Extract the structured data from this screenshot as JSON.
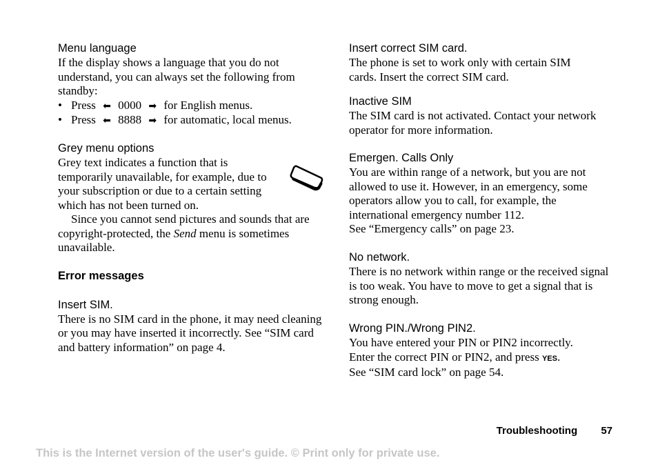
{
  "left_column": {
    "menu_language": {
      "heading": "Menu language",
      "body": "If the display shows a language that you do not understand, you can always set the following from standby:",
      "bullets": [
        {
          "press": "Press",
          "code": "0000",
          "suffix": "for English menus."
        },
        {
          "press": "Press",
          "code": "8888",
          "suffix": "for automatic, local menus."
        }
      ]
    },
    "grey_menu": {
      "heading": "Grey menu options",
      "body": "Grey text indicates a function that is temporarily unavailable, for example, due to your subscription or due to a certain setting which has not been turned on.",
      "body2_a": "Since you cannot send pictures and sounds that are copyright-protected, the ",
      "body2_em": "Send",
      "body2_b": " menu is sometimes unavailable."
    },
    "error_title": "Error messages",
    "insert_sim": {
      "heading": "Insert SIM.",
      "body": "There is no SIM card in the phone, it may need cleaning or you may have inserted it incorrectly. See “SIM card and battery information” on page 4."
    }
  },
  "right_column": {
    "insert_correct": {
      "heading": "Insert correct SIM card.",
      "body": "The phone is set to work only with certain SIM cards. Insert the correct SIM card."
    },
    "inactive": {
      "heading": "Inactive SIM",
      "body": "The SIM card is not activated. Contact your network operator for more information."
    },
    "emergency": {
      "heading": "Emergen. Calls Only",
      "body": "You are within range of a network, but you are not allowed to use it. However, in an emergency, some operators allow you to call, for example, the international emergency number 112.",
      "ref": "See “Emergency calls” on page 23."
    },
    "no_network": {
      "heading": "No network.",
      "body": "There is no network within range or the received signal is too weak. You have to move to get a signal that is strong enough."
    },
    "wrong_pin": {
      "heading": "Wrong PIN./Wrong PIN2.",
      "body1": "You have entered your PIN or PIN2 incorrectly.",
      "body2": "Enter the correct PIN or PIN2, and press ",
      "key": "YES",
      "body2_end": ".",
      "ref": "See “SIM card lock” on page 54."
    }
  },
  "footer": {
    "section": "Troubleshooting",
    "page": "57",
    "notice": "This is the Internet version of the user's guide. © Print only for private use."
  },
  "icons": {
    "left_arrow": "left-arrow-key",
    "right_arrow": "right-arrow-key",
    "sim_card": "sim-card-note"
  }
}
